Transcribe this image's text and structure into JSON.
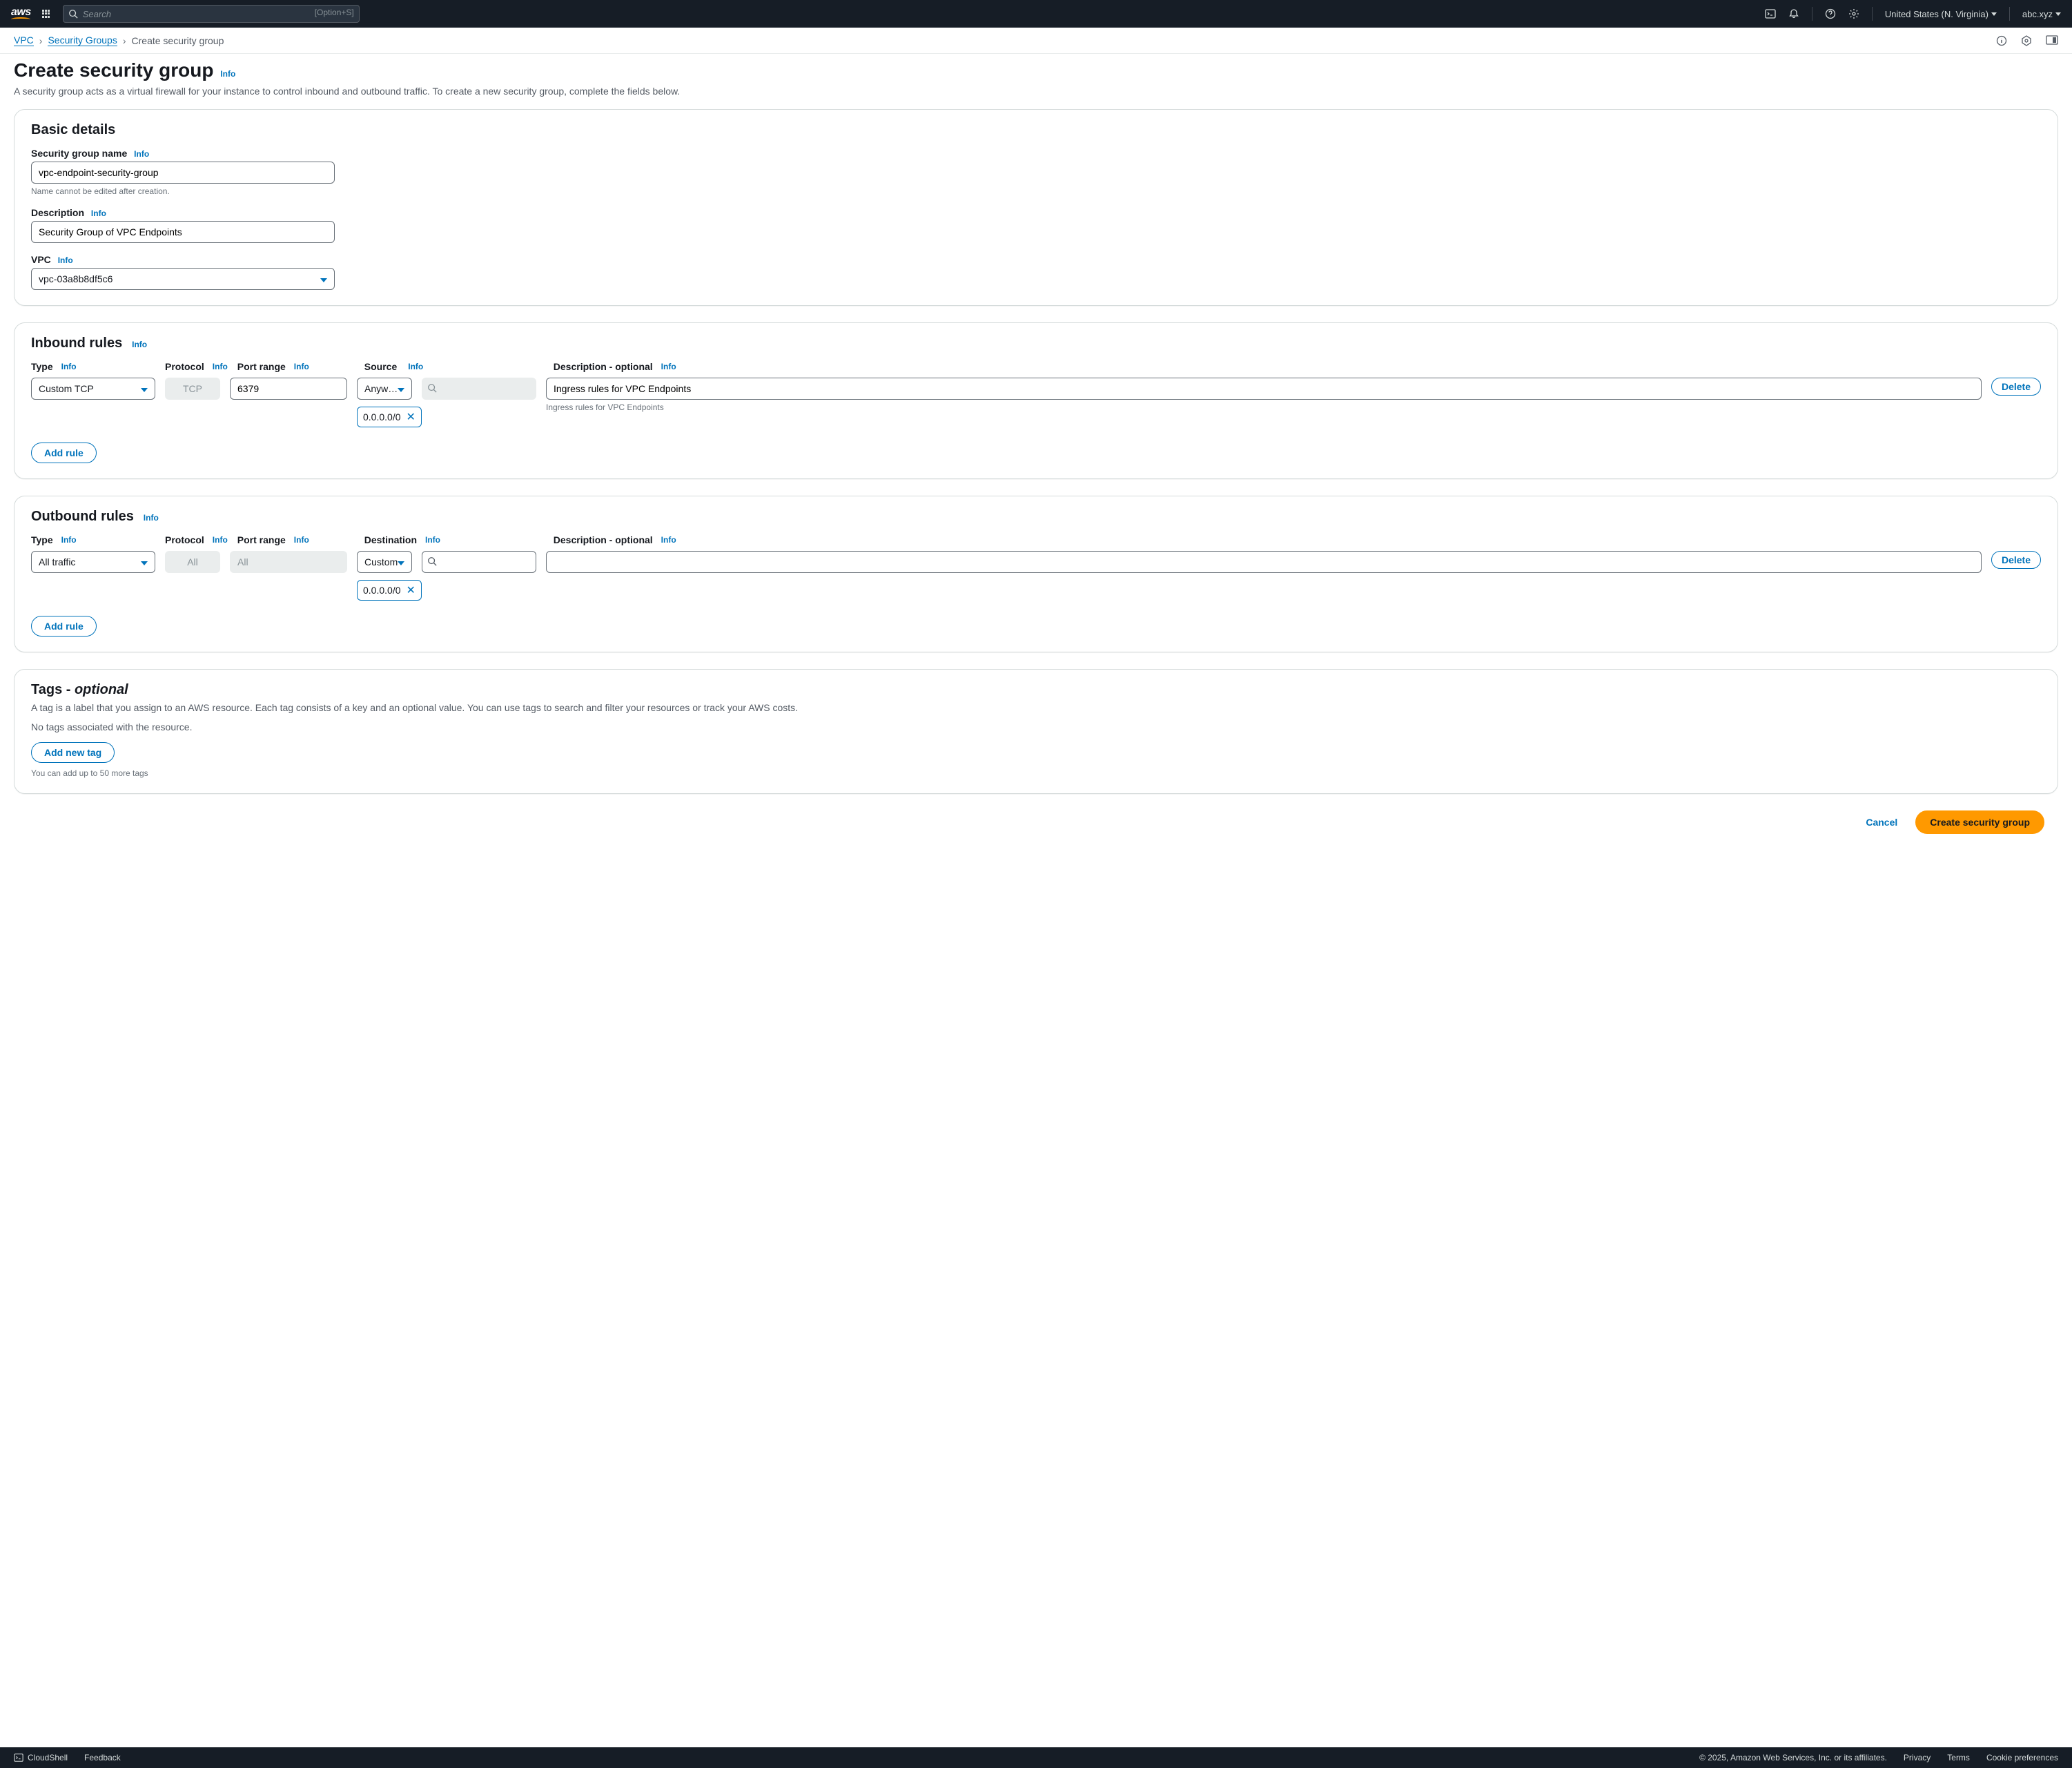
{
  "topnav": {
    "search_placeholder": "Search",
    "search_kbd": "[Option+S]",
    "region": "United States (N. Virginia)",
    "user": "abc.xyz"
  },
  "breadcrumbs": {
    "a": "VPC",
    "b": "Security Groups",
    "c": "Create security group"
  },
  "page": {
    "title": "Create security group",
    "info": "Info",
    "desc": "A security group acts as a virtual firewall for your instance to control inbound and outbound traffic. To create a new security group, complete the fields below."
  },
  "basic": {
    "title": "Basic details",
    "name_label": "Security group name",
    "name_value": "vpc-endpoint-security-group",
    "name_hint": "Name cannot be edited after creation.",
    "desc_label": "Description",
    "desc_value": "Security Group of VPC Endpoints",
    "vpc_label": "VPC",
    "vpc_value": "vpc-03a8b8df5c6"
  },
  "inbound": {
    "title": "Inbound rules",
    "headers": {
      "type": "Type",
      "protocol": "Protocol",
      "port": "Port range",
      "source": "Source",
      "desc": "Description - optional"
    },
    "rule": {
      "type": "Custom TCP",
      "protocol": "TCP",
      "port": "6379",
      "source_sel": "Anyw…",
      "cidr": "0.0.0.0/0",
      "desc": "Ingress rules for VPC Endpoints",
      "hint": "Ingress rules for VPC Endpoints",
      "delete": "Delete"
    },
    "add": "Add rule"
  },
  "outbound": {
    "title": "Outbound rules",
    "headers": {
      "type": "Type",
      "protocol": "Protocol",
      "port": "Port range",
      "dest": "Destination",
      "desc": "Description - optional"
    },
    "rule": {
      "type": "All traffic",
      "protocol": "All",
      "port": "All",
      "dest_sel": "Custom",
      "cidr": "0.0.0.0/0",
      "desc": "",
      "delete": "Delete"
    },
    "add": "Add rule"
  },
  "tags": {
    "title_a": "Tags - ",
    "title_b": "optional",
    "desc": "A tag is a label that you assign to an AWS resource. Each tag consists of a key and an optional value. You can use tags to search and filter your resources or track your AWS costs.",
    "empty": "No tags associated with the resource.",
    "add": "Add new tag",
    "limit": "You can add up to 50 more tags"
  },
  "actions": {
    "cancel": "Cancel",
    "create": "Create security group"
  },
  "footer": {
    "cloudshell": "CloudShell",
    "feedback": "Feedback",
    "copyright": "© 2025, Amazon Web Services, Inc. or its affiliates.",
    "privacy": "Privacy",
    "terms": "Terms",
    "cookies": "Cookie preferences"
  },
  "info_text": "Info"
}
